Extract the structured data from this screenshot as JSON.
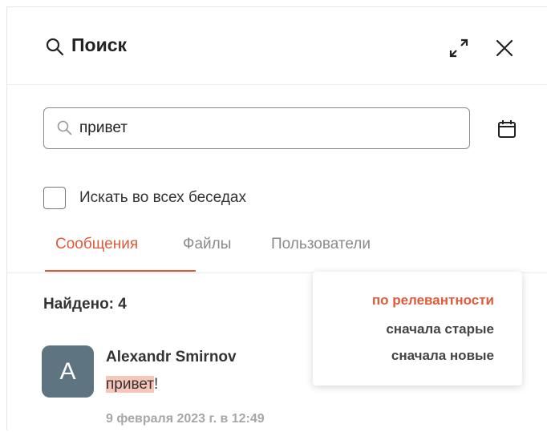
{
  "header": {
    "title": "Поиск",
    "icons": {
      "search": "search-icon",
      "expand": "expand-icon",
      "close": "close-icon"
    }
  },
  "search": {
    "value": "привет",
    "placeholder": "",
    "calendar_icon": "calendar-icon"
  },
  "filter": {
    "all_chats_label": "Искать во всех беседах",
    "all_chats_checked": false
  },
  "tabs": [
    {
      "label": "Сообщения",
      "active": true
    },
    {
      "label": "Файлы",
      "active": false
    },
    {
      "label": "Пользователи",
      "active": false
    }
  ],
  "results": {
    "found_label": "Найдено: 4",
    "items": [
      {
        "avatar_letter": "A",
        "author": "Alexandr Smirnov",
        "text_highlight": "привет",
        "text_rest": "!",
        "date": "9 февраля 2023 г. в 12:49"
      }
    ]
  },
  "sort_menu": {
    "options": [
      {
        "label": "по релевантности",
        "active": true
      },
      {
        "label": "сначала старые",
        "active": false
      },
      {
        "label": "сначала новые",
        "active": false
      }
    ]
  },
  "colors": {
    "accent": "#e05a3a",
    "avatar_bg": "#5e7581",
    "highlight": "#f6c7b8",
    "muted": "#8a8a8a"
  }
}
